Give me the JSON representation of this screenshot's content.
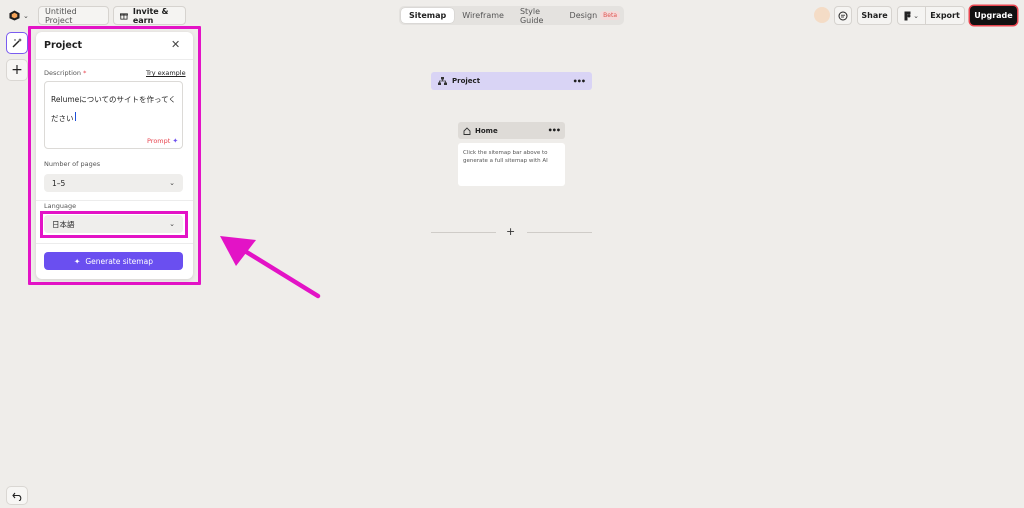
{
  "topbar": {
    "project_name": "Untitled Project",
    "invite_label": "Invite & earn",
    "share_label": "Share",
    "export_label": "Export",
    "upgrade_label": "Upgrade"
  },
  "tabs": [
    {
      "label": "Sitemap",
      "active": true
    },
    {
      "label": "Wireframe",
      "active": false
    },
    {
      "label": "Style Guide",
      "active": false
    },
    {
      "label": "Design",
      "badge": "Beta",
      "active": false
    }
  ],
  "panel": {
    "title": "Project",
    "description_label": "Description",
    "required_mark": "*",
    "try_example": "Try example",
    "description_value": "Relumeについてのサイトを作ってください",
    "prompt_label": "Prompt",
    "pages_label": "Number of pages",
    "pages_value": "1–5",
    "language_label": "Language",
    "language_value": "日本語",
    "generate_label": "Generate sitemap"
  },
  "canvas": {
    "project_node": "Project",
    "home_node": "Home",
    "home_hint": "Click the sitemap bar above to generate a full sitemap with AI"
  },
  "colors": {
    "accent": "#6a4ff0",
    "highlight": "#e313c6",
    "canvas_bg": "#efedea",
    "project_node_bg": "#d9d4f5",
    "required": "#e8454f"
  }
}
